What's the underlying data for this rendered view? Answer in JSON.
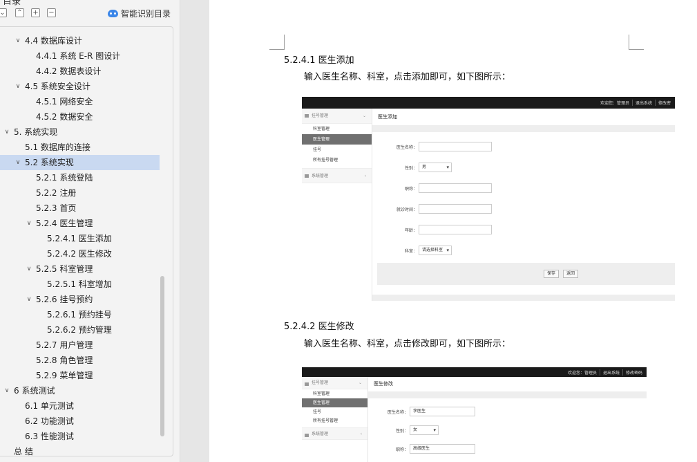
{
  "nav": {
    "title": "目录",
    "toolbar": {
      "collapse": "⌄",
      "up": "⌃",
      "expand_all": "+",
      "collapse_all": "−"
    },
    "smart_toc_label": "智能识别目录",
    "items": [
      {
        "text": "4.4  数据库设计",
        "level": 1,
        "expanded": true
      },
      {
        "text": "4.4.1  系统 E-R 图设计",
        "level": 2
      },
      {
        "text": "4.4.2  数据表设计",
        "level": 2
      },
      {
        "text": "4.5  系统安全设计",
        "level": 1,
        "expanded": true
      },
      {
        "text": "4.5.1  网络安全",
        "level": 2
      },
      {
        "text": "4.5.2  数据安全",
        "level": 2
      },
      {
        "text": "5.  系统实现",
        "level": 0,
        "expanded": true
      },
      {
        "text": "5.1  数据库的连接",
        "level": 1
      },
      {
        "text": "5.2  系统实现",
        "level": 1,
        "expanded": true,
        "selected": true
      },
      {
        "text": "5.2.1  系统登陆",
        "level": 2
      },
      {
        "text": "5.2.2  注册",
        "level": 2
      },
      {
        "text": "5.2.3  首页",
        "level": 2
      },
      {
        "text": "5.2.4  医生管理",
        "level": 2,
        "expanded": true
      },
      {
        "text": "5.2.4.1  医生添加",
        "level": 3
      },
      {
        "text": "5.2.4.2 医生修改",
        "level": 3
      },
      {
        "text": "5.2.5  科室管理",
        "level": 2,
        "expanded": true
      },
      {
        "text": "5.2.5.1  科室增加",
        "level": 3
      },
      {
        "text": "5.2.6  挂号预约",
        "level": 2,
        "expanded": true
      },
      {
        "text": "5.2.6.1 预约挂号",
        "level": 3
      },
      {
        "text": "5.2.6.2 预约管理",
        "level": 3
      },
      {
        "text": "5.2.7  用户管理",
        "level": 2
      },
      {
        "text": "5.2.8 角色管理",
        "level": 2
      },
      {
        "text": "5.2.9 菜单管理",
        "level": 2
      },
      {
        "text": "6 系统测试",
        "level": 0,
        "expanded": true
      },
      {
        "text": "6.1 单元测试",
        "level": 1
      },
      {
        "text": "6.2 功能测试",
        "level": 1
      },
      {
        "text": "6.3 性能测试",
        "level": 1
      },
      {
        "text": "总  结",
        "level": 0
      }
    ]
  },
  "doc": {
    "section1": {
      "heading": "5.2.4.1  医生添加",
      "body": "输入医生名称、科室，点击添加即可，如下图所示：",
      "shot": {
        "top_links": [
          "欢迎您：管理员",
          "退出系统",
          "修改密"
        ],
        "side_head": "挂号管理",
        "side_items": [
          "科室管理",
          "医生管理",
          "挂号",
          "所有挂号管理"
        ],
        "side_head2": "系统管理",
        "title": "医生添加",
        "fields": [
          {
            "label": "医生名称：",
            "value": ""
          },
          {
            "label": "性别：",
            "value": "男"
          },
          {
            "label": "职称：",
            "value": ""
          },
          {
            "label": "就诊时间：",
            "value": ""
          },
          {
            "label": "年龄：",
            "value": ""
          },
          {
            "label": "科室：",
            "value": "请选择科室"
          }
        ],
        "save": "保存",
        "back": "返回"
      }
    },
    "section2": {
      "heading": "5.2.4.2 医生修改",
      "body": "输入医生名称、科室，点击修改即可，如下图所示：",
      "shot": {
        "top_links": [
          "欢迎您：管理员",
          "退出系统",
          "修改密码"
        ],
        "side_head": "挂号管理",
        "side_items": [
          "科室管理",
          "医生管理",
          "挂号",
          "所有挂号管理"
        ],
        "side_head2": "系统管理",
        "title": "医生修改",
        "fields": [
          {
            "label": "医生名称：",
            "value": "李医生"
          },
          {
            "label": "性别：",
            "value": "女"
          },
          {
            "label": "职称：",
            "value": "高级医生"
          }
        ]
      }
    }
  }
}
